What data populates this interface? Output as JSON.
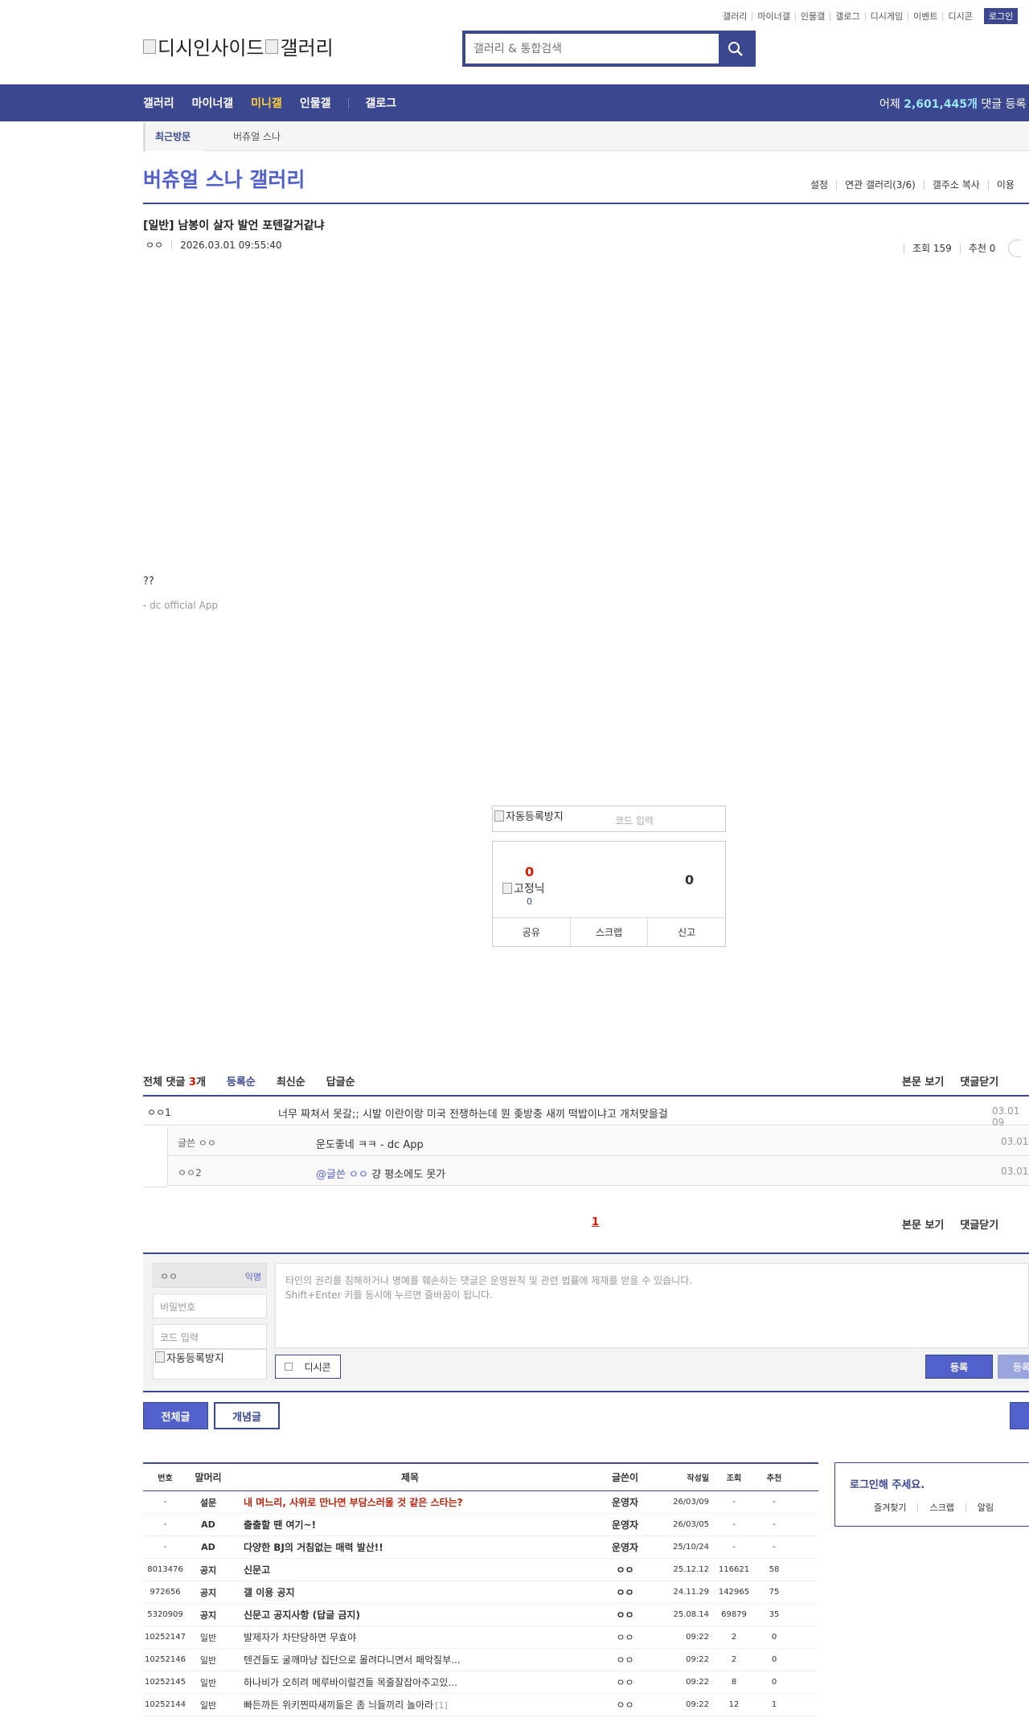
{
  "toplinks": [
    "갤러리",
    "마이너갤",
    "인물갤",
    "갤로그",
    "디시게임",
    "이벤트",
    "디시콘"
  ],
  "login_btn": "로그인",
  "logo": {
    "site": "디시인사이드",
    "section": "갤러리"
  },
  "search": {
    "placeholder": "갤러리 & 통합검색"
  },
  "nav": {
    "items": [
      "갤러리",
      "마이너갤",
      "미니갤",
      "인물갤",
      "갤로그"
    ],
    "active": "미니갤",
    "count_prefix": "어제",
    "count_value": "2,601,445개",
    "count_suffix": "댓글 등록"
  },
  "recent": {
    "tag": "최근방문",
    "item": "버츄얼 스나"
  },
  "gallery": {
    "title": "버츄얼 스나 갤러리",
    "options": [
      "설정",
      "연관 갤러리(3/6)",
      "갤주소 복사",
      "이용"
    ]
  },
  "post": {
    "title": "[일반] 남봉이 살자 발언 포텐갈거같냐",
    "author": "ㅇㅇ",
    "datetime": "2026.03.01 09:55:40",
    "views": "조회 159",
    "recommends": "추천 0",
    "body": "??",
    "signature": "- dc official App"
  },
  "recommend": {
    "captcha_img": "자동등록방지",
    "captcha_placeholder": "코드 입력",
    "up": "0",
    "fix_img": "고정닉",
    "fix_count": "0",
    "down": "0",
    "actions": [
      "공유",
      "스크랩",
      "신고"
    ]
  },
  "comments": {
    "total_label": "전체 댓글",
    "total_count": "3",
    "total_unit": "개",
    "sorts": [
      "등록순",
      "최신순",
      "답글순"
    ],
    "right_links": [
      "본문 보기",
      "댓글닫기"
    ],
    "items": [
      {
        "author": "ㅇㅇ1",
        "text": "너무 짜쳐서 못갈;; 시발 이란이랑 미국 전쟁하는데 뭔 좆방충 새끼 떡밥이냐고 개처맞을걸",
        "date": "03.01 09"
      }
    ],
    "replies": [
      {
        "author": "글쓴 ㅇㅇ",
        "mention": "",
        "text": "운도좋네 ㅋㅋ - dc App",
        "date": "03.01"
      },
      {
        "author": "ㅇㅇ2",
        "mention": "@글쓴 ㅇㅇ",
        "text": "걍 평소에도 못가",
        "date": "03.01"
      }
    ],
    "page": "1"
  },
  "write": {
    "name": "ㅇㅇ",
    "anon": "익명",
    "password_placeholder": "비밀번호",
    "code_placeholder": "코드 입력",
    "captcha_img": "자동등록방지",
    "notice_line1": "타인의 권리를 침해하거나 명예를 훼손하는 댓글은 운영원칙 및 관련 법률에 제재를 받을 수 있습니다.",
    "notice_line2": "Shift+Enter 키를 동시에 누르면 줄바꿈이 됩니다.",
    "dccon": "디시콘",
    "submit": "등록",
    "submit2": "등록"
  },
  "list_tabs": {
    "all": "전체글",
    "best": "개념글"
  },
  "list": {
    "headers": {
      "no": "번호",
      "subject": "말머리",
      "title": "제목",
      "writer": "글쓴이",
      "date": "작성일",
      "views": "조회",
      "rec": "추천"
    },
    "rows": [
      {
        "no": "-",
        "subject": "설문",
        "title": "내 며느리, 사위로 만나면 부담스러울 것 같은 스타는?",
        "reply": "",
        "writer": "운영자",
        "date": "26/03/09",
        "views": "-",
        "rec": "-"
      },
      {
        "no": "-",
        "subject": "AD",
        "title": "출출할 땐 여기~!",
        "reply": "",
        "writer": "운영자",
        "date": "26/03/05",
        "views": "-",
        "rec": "-"
      },
      {
        "no": "-",
        "subject": "AD",
        "title": "다양한 BJ의 거침없는 매력 발산!!",
        "reply": "",
        "writer": "운영자",
        "date": "25/10/24",
        "views": "-",
        "rec": "-"
      },
      {
        "no": "8013476",
        "subject": "공지",
        "title": "신문고",
        "reply": "",
        "writer": "ㅇㅇ",
        "date": "25.12.12",
        "views": "116621",
        "rec": "58"
      },
      {
        "no": "972656",
        "subject": "공지",
        "title": "갤 이용 공지",
        "reply": "",
        "writer": "ㅇㅇ",
        "date": "24.11.29",
        "views": "142965",
        "rec": "75"
      },
      {
        "no": "5320909",
        "subject": "공지",
        "title": "신문고 공지사항 (답글 금지)",
        "reply": "",
        "writer": "ㅇㅇ",
        "date": "25.08.14",
        "views": "69879",
        "rec": "35"
      },
      {
        "no": "10252147",
        "subject": "일반",
        "title": "발제자가 차단당하면 무효야",
        "reply": "",
        "writer": "ㅇㅇ",
        "date": "09:22",
        "views": "2",
        "rec": "0"
      },
      {
        "no": "10252146",
        "subject": "일반",
        "title": "텐견들도 굴깨마냥 집단으로 몰려다니면서 패악질부...",
        "reply": "",
        "writer": "ㅇㅇ",
        "date": "09:22",
        "views": "2",
        "rec": "0"
      },
      {
        "no": "10252145",
        "subject": "일반",
        "title": "하나비가 오히려 메루바이럴견들 목줄잘잡아주고있...",
        "reply": "",
        "writer": "ㅇㅇ",
        "date": "09:22",
        "views": "8",
        "rec": "0"
      },
      {
        "no": "10252144",
        "subject": "일반",
        "title": "빠든까든 위키찐따새끼들은 좀 늬들끼리 놀아라",
        "reply": "[1]",
        "writer": "ㅇㅇ",
        "date": "09:22",
        "views": "12",
        "rec": "1"
      }
    ]
  },
  "loginbox": {
    "title": "로그인해 주세요.",
    "actions": [
      "즐겨찾기",
      "스크랩",
      "알림"
    ]
  },
  "colors": {
    "brand": "#3b4890",
    "accent": "#5161c9",
    "active_nav": "#ffd136",
    "count": "#9de5ff",
    "red": "#d31900"
  }
}
